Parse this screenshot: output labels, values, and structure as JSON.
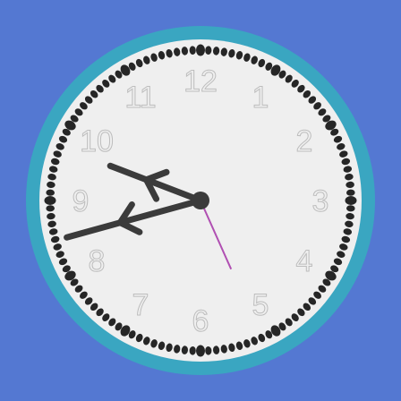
{
  "clock": {
    "colors": {
      "background": "#5478d2",
      "rim": "#3aa6c1",
      "face": "#efefef",
      "dots": "#262626",
      "numerals": "#bdbdbd",
      "hands": "#3b3b3b",
      "second_hand": "#b04fb2"
    },
    "numerals": [
      "12",
      "1",
      "2",
      "3",
      "4",
      "5",
      "6",
      "7",
      "8",
      "9",
      "10",
      "11"
    ],
    "time": {
      "hour": 9,
      "minute": 42,
      "second": 26
    }
  }
}
